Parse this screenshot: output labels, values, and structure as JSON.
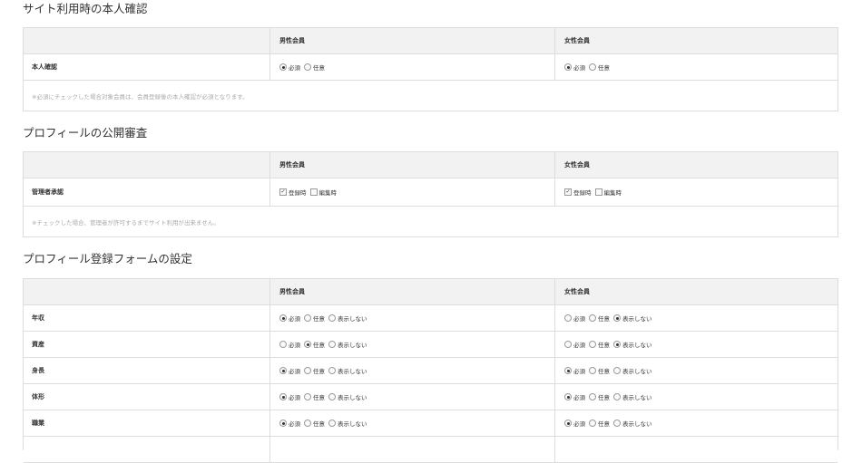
{
  "sections": [
    {
      "title": "サイト利用時の本人確認",
      "header": {
        "blank": "",
        "male": "男性会員",
        "female": "女性会員"
      },
      "rows": [
        {
          "label": "本人確認",
          "male": [
            {
              "label": "必須",
              "checked": true
            },
            {
              "label": "任意",
              "checked": false
            }
          ],
          "female": [
            {
              "label": "必須",
              "checked": true
            },
            {
              "label": "任意",
              "checked": false
            }
          ]
        }
      ],
      "note": "※必須にチェックした場合対象会員は、会員登録後の本人確認が必須となります。"
    },
    {
      "title": "プロフィールの公開審査",
      "header": {
        "blank": "",
        "male": "男性会員",
        "female": "女性会員"
      },
      "rows": [
        {
          "label": "管理者承認",
          "male": [
            {
              "label": "登録時",
              "checked": true
            },
            {
              "label": "編集時",
              "checked": false
            }
          ],
          "female": [
            {
              "label": "登録時",
              "checked": true
            },
            {
              "label": "編集時",
              "checked": false
            }
          ]
        }
      ],
      "note": "※チェックした場合、管理者が許可するまでサイト利用が出来ません。"
    },
    {
      "title": "プロフィール登録フォームの設定",
      "header": {
        "blank": "",
        "male": "男性会員",
        "female": "女性会員"
      },
      "rows": [
        {
          "label": "年収",
          "male": [
            {
              "label": "必須",
              "checked": true
            },
            {
              "label": "任意",
              "checked": false
            },
            {
              "label": "表示しない",
              "checked": false
            }
          ],
          "female": [
            {
              "label": "必須",
              "checked": false
            },
            {
              "label": "任意",
              "checked": false
            },
            {
              "label": "表示しない",
              "checked": true
            }
          ]
        },
        {
          "label": "資産",
          "male": [
            {
              "label": "必須",
              "checked": false
            },
            {
              "label": "任意",
              "checked": true
            },
            {
              "label": "表示しない",
              "checked": false
            }
          ],
          "female": [
            {
              "label": "必須",
              "checked": false
            },
            {
              "label": "任意",
              "checked": false
            },
            {
              "label": "表示しない",
              "checked": true
            }
          ]
        },
        {
          "label": "身長",
          "male": [
            {
              "label": "必須",
              "checked": true
            },
            {
              "label": "任意",
              "checked": false
            },
            {
              "label": "表示しない",
              "checked": false
            }
          ],
          "female": [
            {
              "label": "必須",
              "checked": true
            },
            {
              "label": "任意",
              "checked": false
            },
            {
              "label": "表示しない",
              "checked": false
            }
          ]
        },
        {
          "label": "体形",
          "male": [
            {
              "label": "必須",
              "checked": true
            },
            {
              "label": "任意",
              "checked": false
            },
            {
              "label": "表示しない",
              "checked": false
            }
          ],
          "female": [
            {
              "label": "必須",
              "checked": true
            },
            {
              "label": "任意",
              "checked": false
            },
            {
              "label": "表示しない",
              "checked": false
            }
          ]
        },
        {
          "label": "職業",
          "male": [
            {
              "label": "必須",
              "checked": true
            },
            {
              "label": "任意",
              "checked": false
            },
            {
              "label": "表示しない",
              "checked": false
            }
          ],
          "female": [
            {
              "label": "必須",
              "checked": true
            },
            {
              "label": "任意",
              "checked": false
            },
            {
              "label": "表示しない",
              "checked": false
            }
          ]
        }
      ]
    }
  ]
}
